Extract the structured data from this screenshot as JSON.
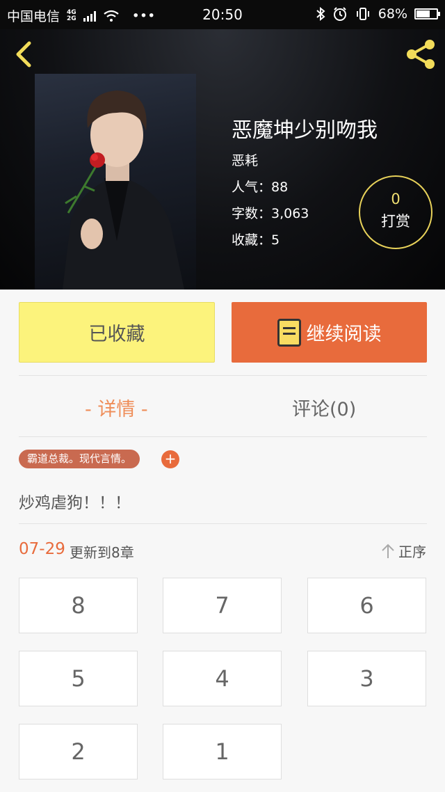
{
  "status_bar": {
    "carrier": "中国电信",
    "network_top": "4G",
    "network_bottom": "2G",
    "dots": "•••",
    "time": "20:50",
    "battery": "68%",
    "battery_level": 0.68
  },
  "book": {
    "title": "恶魔坤少别吻我",
    "author": "恶耗",
    "popularity": "人气：88",
    "word_count": "字数：3,063",
    "favorites": "收藏：5"
  },
  "reward": {
    "count": "0",
    "label": "打赏"
  },
  "actions": {
    "favorited_label": "已收藏",
    "continue_label": "继续阅读"
  },
  "tabs": {
    "detail": "- 详情 -",
    "comments": "评论(0)"
  },
  "tag": "霸道总裁。现代言情。",
  "tag_add": "+",
  "description": "炒鸡虐狗！！！",
  "update": {
    "date": "07-29",
    "text": "更新到8章"
  },
  "sort_label": "正序",
  "chapters": [
    "8",
    "7",
    "6",
    "5",
    "4",
    "3",
    "2",
    "1"
  ],
  "colors": {
    "accent": "#e86b3c",
    "favorite_bg": "#fcf37c",
    "reward_ring": "#e8d25a"
  }
}
